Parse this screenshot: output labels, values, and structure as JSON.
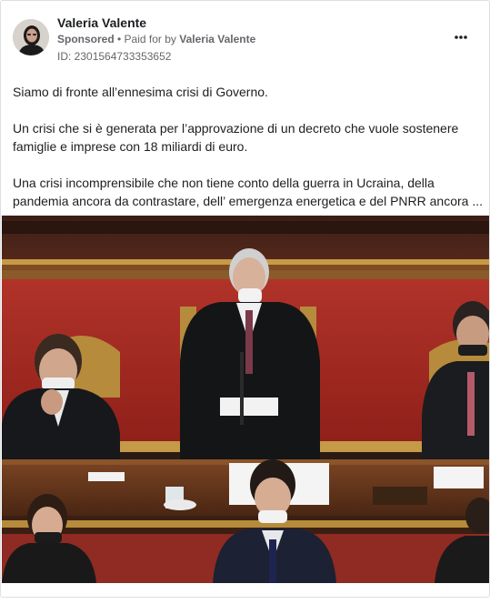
{
  "post": {
    "author": "Valeria Valente",
    "sponsored": "Sponsored",
    "separator": " • ",
    "paid_for_prefix": "Paid for by ",
    "paid_for_name": "Valeria Valente",
    "ad_id": "ID: 2301564733353652",
    "more_icon": "more-horizontal-icon",
    "paragraphs": [
      "Siamo di fronte all’ennesima crisi di Governo.",
      "Un crisi che si è generata per l’approvazione di un decreto che vuole sostenere",
      "famiglie e imprese con 18 miliardi di euro.",
      "Una crisi incomprensibile che non tiene conto della guerra in Ucraina, della",
      "pandemia ancora da contrastare, dell’ emergenza energetica e del PNRR ancora ..."
    ]
  },
  "colors": {
    "text_primary": "#1c1e21",
    "text_secondary": "#65676b",
    "border": "#dddfe2",
    "chamber_red": "#a2261f",
    "wood": "#6b3a1f"
  }
}
